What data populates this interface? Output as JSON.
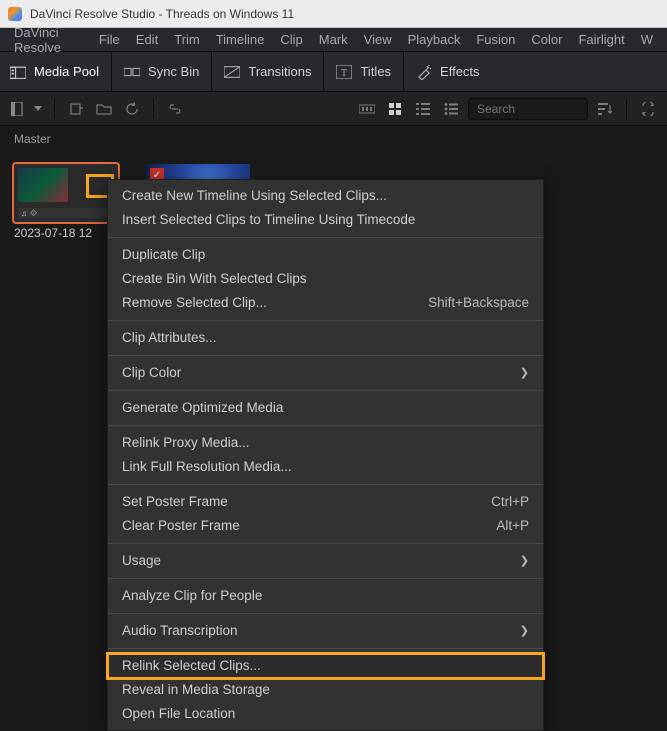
{
  "window": {
    "title": "DaVinci Resolve Studio - Threads on Windows 11"
  },
  "menubar": [
    "DaVinci Resolve",
    "File",
    "Edit",
    "Trim",
    "Timeline",
    "Clip",
    "Mark",
    "View",
    "Playback",
    "Fusion",
    "Color",
    "Fairlight",
    "W"
  ],
  "toolbar": {
    "groups": [
      {
        "icon": "media-pool-icon",
        "label": "Media Pool",
        "active": true
      },
      {
        "icon": "sync-bin-icon",
        "label": "Sync Bin"
      },
      {
        "icon": "transitions-icon",
        "label": "Transitions"
      },
      {
        "icon": "titles-icon",
        "label": "Titles"
      },
      {
        "icon": "effects-icon",
        "label": "Effects"
      }
    ]
  },
  "secondbar": {
    "search_placeholder": "Search"
  },
  "breadcrumb": "Master",
  "clips": [
    {
      "label": "2023-07-18 12",
      "selected": true,
      "highlighted": true
    },
    {
      "label": "",
      "selected": false
    }
  ],
  "context_menu": [
    {
      "type": "item",
      "label": "Create New Timeline Using Selected Clips..."
    },
    {
      "type": "item",
      "label": "Insert Selected Clips to Timeline Using Timecode"
    },
    {
      "type": "sep"
    },
    {
      "type": "item",
      "label": "Duplicate Clip"
    },
    {
      "type": "item",
      "label": "Create Bin With Selected Clips"
    },
    {
      "type": "item",
      "label": "Remove Selected Clip...",
      "shortcut": "Shift+Backspace"
    },
    {
      "type": "sep"
    },
    {
      "type": "item",
      "label": "Clip Attributes..."
    },
    {
      "type": "sep"
    },
    {
      "type": "item",
      "label": "Clip Color",
      "submenu": true
    },
    {
      "type": "sep"
    },
    {
      "type": "item",
      "label": "Generate Optimized Media"
    },
    {
      "type": "sep"
    },
    {
      "type": "item",
      "label": "Relink Proxy Media..."
    },
    {
      "type": "item",
      "label": "Link Full Resolution Media..."
    },
    {
      "type": "sep"
    },
    {
      "type": "item",
      "label": "Set Poster Frame",
      "shortcut": "Ctrl+P"
    },
    {
      "type": "item",
      "label": "Clear Poster Frame",
      "shortcut": "Alt+P"
    },
    {
      "type": "sep"
    },
    {
      "type": "item",
      "label": "Usage",
      "submenu": true
    },
    {
      "type": "sep"
    },
    {
      "type": "item",
      "label": "Analyze Clip for People"
    },
    {
      "type": "sep"
    },
    {
      "type": "item",
      "label": "Audio Transcription",
      "submenu": true
    },
    {
      "type": "sep"
    },
    {
      "type": "item",
      "label": "Relink Selected Clips...",
      "highlighted": true
    },
    {
      "type": "item",
      "label": "Reveal in Media Storage"
    },
    {
      "type": "item",
      "label": "Open File Location"
    }
  ]
}
